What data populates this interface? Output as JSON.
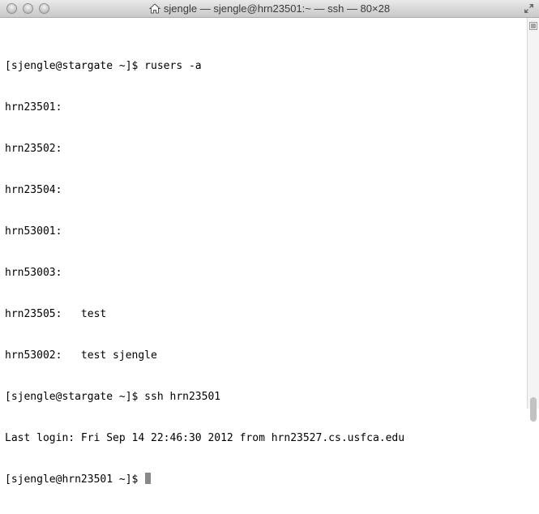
{
  "window": {
    "title": "sjengle — sjengle@hrn23501:~ — ssh — 80×28"
  },
  "terminal": {
    "lines": [
      "[sjengle@stargate ~]$ rusers -a",
      "hrn23501:",
      "hrn23502:",
      "hrn23504:",
      "hrn53001:",
      "hrn53003:",
      "hrn23505:   test",
      "hrn53002:   test sjengle",
      "[sjengle@stargate ~]$ ssh hrn23501",
      "Last login: Fri Sep 14 22:46:30 2012 from hrn23527.cs.usfca.edu"
    ],
    "prompt": "[sjengle@hrn23501 ~]$ "
  },
  "icons": {
    "title_icon": "home-icon",
    "fullscreen": "fullscreen-icon",
    "scroll": "scroll-bars-icon"
  }
}
